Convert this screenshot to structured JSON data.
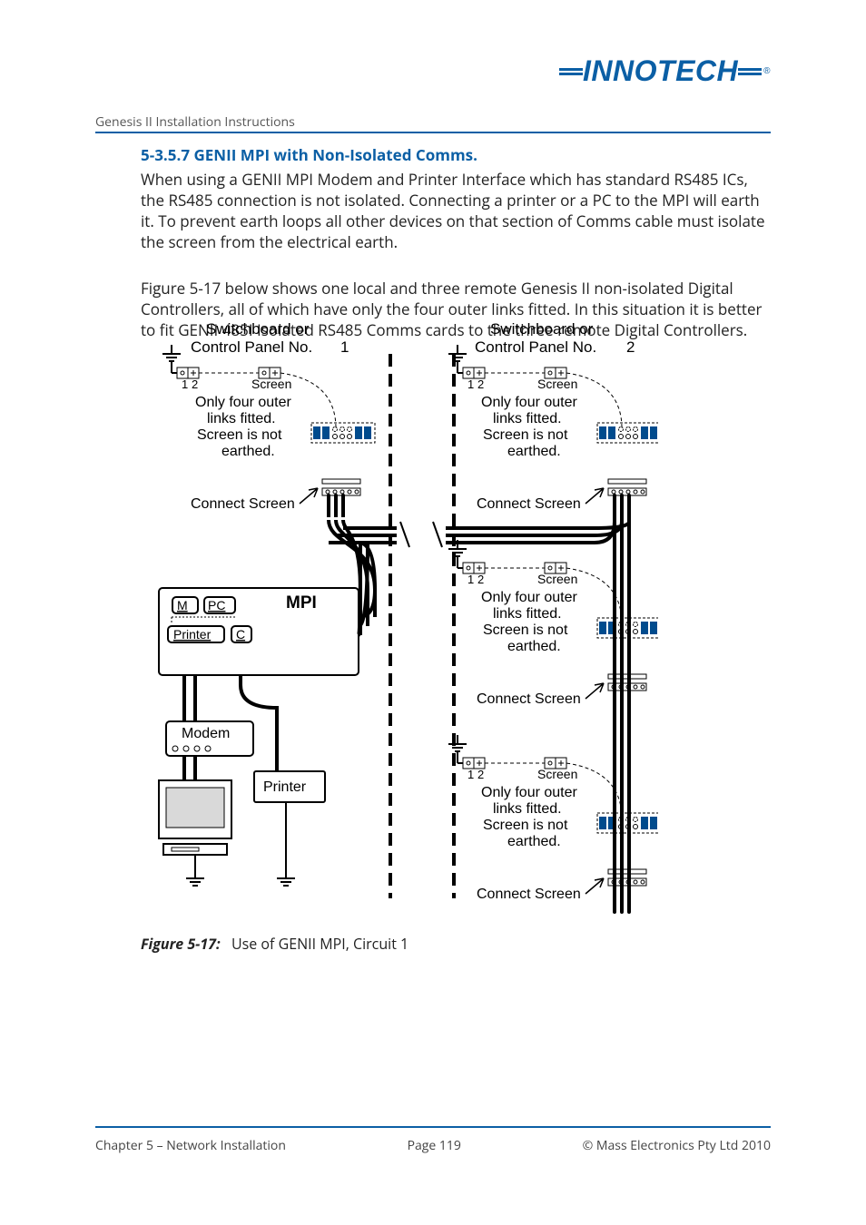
{
  "brand": "INNOTECH",
  "header": {
    "doc_title": "Genesis II Installation Instructions"
  },
  "section": {
    "heading": "5-3.5.7 GENII MPI with Non-Isolated Comms.",
    "para1": "When using a GENII MPI Modem and Printer Interface which has standard RS485 ICs, the RS485 connection is not isolated.  Connecting a printer or a PC to the MPI will earth it.  To prevent earth loops all other devices on that section of Comms cable must isolate the screen from the electrical earth.",
    "para2": "Figure 5-17 below shows one local and three remote Genesis II non-isolated Digital Controllers, all of which have only the four outer links fitted.  In this situation it is better to fit GENII 485I Isolated RS485 Comms cards to the three remote Digital Controllers."
  },
  "figure": {
    "caption_label": "Figure 5-17:",
    "caption_text": "Use of GENII MPI, Circuit 1",
    "labels": {
      "switchboard": "Switchboard or",
      "control_panel": "Control Panel No.",
      "num1": "1",
      "num2": "2",
      "one": "1",
      "two": "2",
      "screen": "Screen",
      "note_l1": "Only four outer",
      "note_l2": "links fitted.",
      "note_l3": "Screen is not",
      "note_l4": "earthed.",
      "connect_screen": "Connect Screen",
      "mpi": "MPI",
      "m": "M",
      "pc": "PC",
      "c": "C",
      "printer_btn": "Printer",
      "modem": "Modem",
      "printer_box": "Printer"
    }
  },
  "footer": {
    "left": "Chapter 5 – Network Installation",
    "center": "Page 119",
    "right": "©  Mass Electronics Pty Ltd  2010"
  }
}
